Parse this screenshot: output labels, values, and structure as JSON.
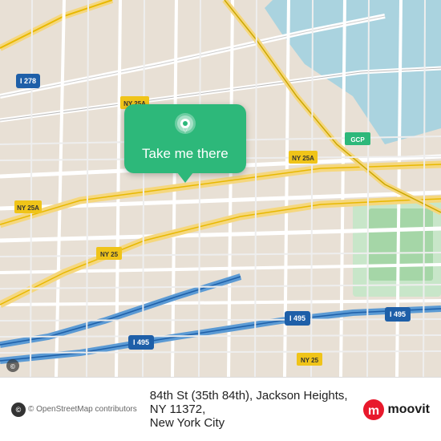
{
  "map": {
    "alt": "Map of Jackson Heights, NY area",
    "center_lat": 40.752,
    "center_lng": -73.883
  },
  "bubble": {
    "label": "Take me there"
  },
  "bottom_bar": {
    "osm_credit": "© OpenStreetMap contributors",
    "address_line1": "84th St (35th 84th), Jackson Heights, NY 11372,",
    "address_line2": "New York City",
    "moovit_label": "moovit"
  },
  "icons": {
    "pin": "location-pin-icon",
    "osm": "openstreetmap-icon",
    "moovit": "moovit-logo-icon"
  }
}
